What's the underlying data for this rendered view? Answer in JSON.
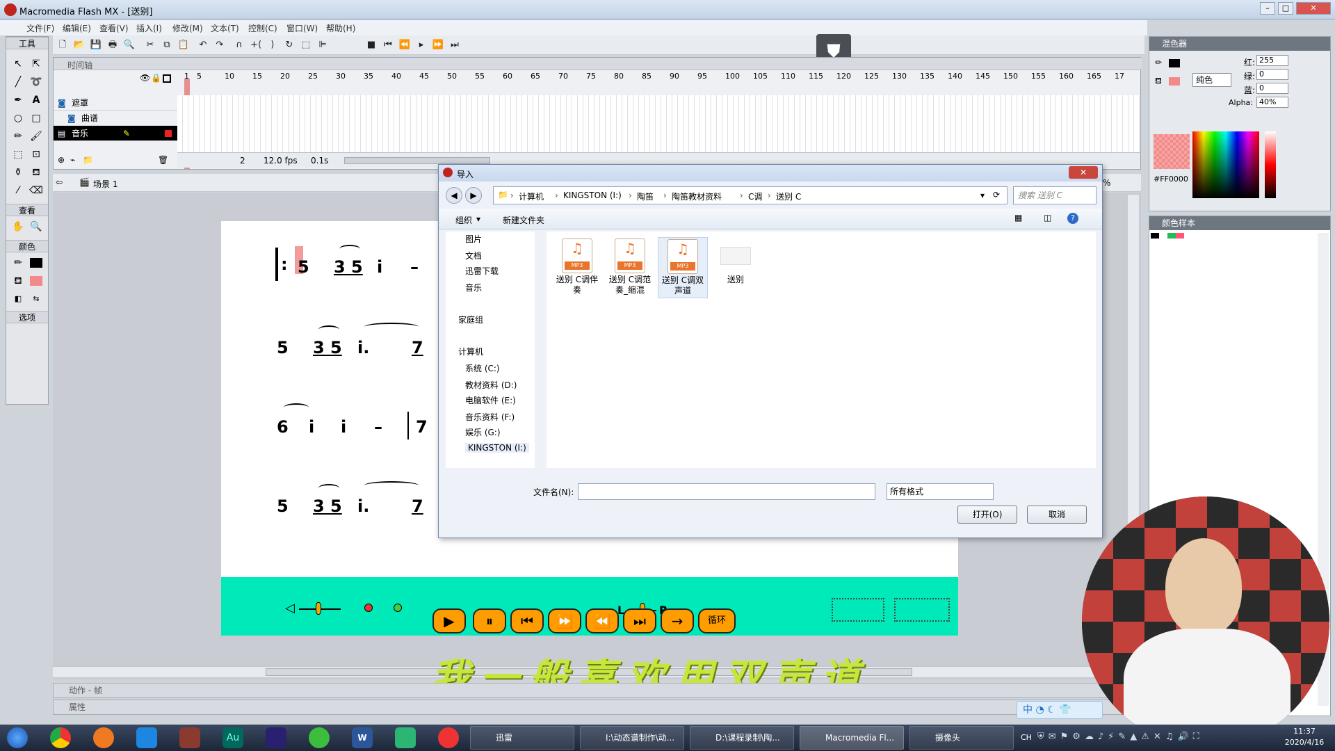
{
  "window": {
    "title": "Macromedia Flash MX - [送别]"
  },
  "menu": [
    "文件(F)",
    "编辑(E)",
    "查看(V)",
    "插入(I)",
    "修改(M)",
    "文本(T)",
    "控制(C)",
    "窗口(W)",
    "帮助(H)"
  ],
  "tools": {
    "title": "工具",
    "view": "查看",
    "colors": "颜色",
    "options": "选项"
  },
  "timeline": {
    "title": "时间轴",
    "frame_numbers": [
      "1",
      "5",
      "10",
      "15",
      "20",
      "25",
      "30",
      "35",
      "40",
      "45",
      "50",
      "55",
      "60",
      "65",
      "70",
      "75",
      "80",
      "85",
      "90",
      "95",
      "100",
      "105",
      "110",
      "115",
      "120",
      "125",
      "130",
      "135",
      "140",
      "145",
      "150",
      "155",
      "160",
      "165",
      "17"
    ],
    "layers": [
      {
        "name": "遮罩"
      },
      {
        "name": "曲谱"
      },
      {
        "name": "音乐"
      }
    ],
    "current_frame": "2",
    "fps": "12.0 fps",
    "time": "0.1s"
  },
  "scene": {
    "name": "场景 1",
    "zoom": "%"
  },
  "score": {
    "rows": [
      [
        "5",
        "3 5",
        "i",
        "–"
      ],
      [
        "5",
        "3 5",
        "i.",
        "7"
      ],
      [
        "6",
        "i",
        "i",
        "–",
        "7"
      ],
      [
        "5",
        "3 5",
        "i.",
        "7"
      ]
    ],
    "controls": [
      "▶",
      "⏸",
      "⏮",
      "⏩",
      "⏪",
      "⏭",
      "→",
      "循环"
    ],
    "balance_left": "L",
    "balance_right": "R"
  },
  "subtitle": "我一般喜欢用双声道",
  "bottom_panels": {
    "actions": "动作 - 帧",
    "properties": "属性"
  },
  "mixer": {
    "title": "混色器",
    "type": "纯色",
    "red_label": "红:",
    "red": "255",
    "green_label": "绿:",
    "green": "0",
    "blue_label": "蓝:",
    "blue": "0",
    "alpha_label": "Alpha:",
    "alpha": "40%",
    "hex": "#FF0000"
  },
  "swatches": {
    "title": "颜色样本"
  },
  "dialog": {
    "title": "导入",
    "breadcrumb": [
      "计算机",
      "KINGSTON (I:)",
      "陶笛",
      "陶笛教材资料",
      "C调",
      "送别 C"
    ],
    "search_placeholder": "搜索 送别 C",
    "organize": "组织",
    "new_folder": "新建文件夹",
    "nav": [
      "图片",
      "文档",
      "迅雷下载",
      "音乐",
      "家庭组",
      "计算机",
      "系统 (C:)",
      "教材资料 (D:)",
      "电脑软件 (E:)",
      "音乐资料 (F:)",
      "娱乐 (G:)",
      "KINGSTON (I:)"
    ],
    "files": [
      {
        "name": "送别 C调伴奏",
        "type": "MP3"
      },
      {
        "name": "送别 C调范奏_缩混",
        "type": "MP3"
      },
      {
        "name": "送别 C调双声道",
        "type": "MP3"
      },
      {
        "name": "送别",
        "type": "doc"
      }
    ],
    "filename_label": "文件名(N):",
    "filename_value": "",
    "filetype": "所有格式",
    "open": "打开(O)",
    "cancel": "取消"
  },
  "taskbar": {
    "tasks": [
      "迅雷",
      "I:\\动态谱制作\\动...",
      "D:\\课程录制\\陶...",
      "Macromedia Fl...",
      "摄像头"
    ],
    "ime": "中",
    "lang": "CH",
    "time": "11:37",
    "date": "2020/4/16"
  },
  "colors": {
    "stage_bar": "#00e9b8",
    "button": "#ff9d00",
    "subtitle": "#c7e63b",
    "accent": "#e9742b"
  }
}
